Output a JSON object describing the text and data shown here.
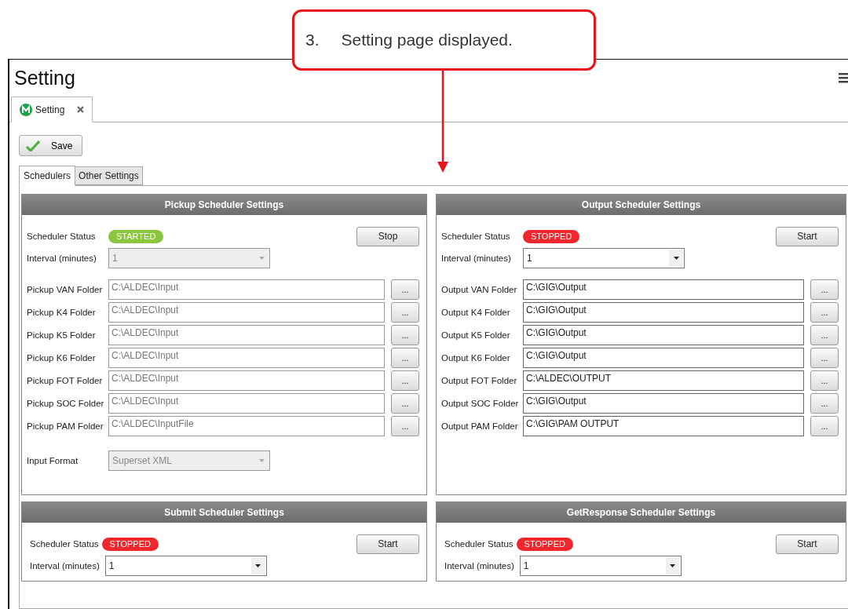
{
  "annotation": {
    "number": "3.",
    "text": "Setting page displayed."
  },
  "window": {
    "title": "Setting"
  },
  "doc_tabs": [
    {
      "label": "Setting",
      "selected": true,
      "closable": true
    }
  ],
  "save_button": "Save",
  "tabs": [
    {
      "label": "Schedulers",
      "selected": true
    },
    {
      "label": "Other Settings",
      "selected": false
    }
  ],
  "panels": [
    {
      "title": "Pickup Scheduler Settings",
      "status_label": "Scheduler Status",
      "status": "STARTED",
      "running": true,
      "action": "Stop",
      "interval_label": "Interval (minutes)",
      "interval": "1",
      "disabled": true,
      "folders": [
        {
          "label": "Pickup VAN Folder",
          "value": "C:\\ALDEC\\Input",
          "browse": "..."
        },
        {
          "label": "Pickup K4 Folder",
          "value": "C:\\ALDEC\\Input",
          "browse": "..."
        },
        {
          "label": "Pickup K5 Folder",
          "value": "C:\\ALDEC\\Input",
          "browse": "..."
        },
        {
          "label": "Pickup K6 Folder",
          "value": "C:\\ALDEC\\Input",
          "browse": "..."
        },
        {
          "label": "Pickup FOT Folder",
          "value": "C:\\ALDEC\\Input",
          "browse": "..."
        },
        {
          "label": "Pickup SOC Folder",
          "value": "C:\\ALDEC\\Input",
          "browse": "..."
        },
        {
          "label": "Pickup PAM Folder",
          "value": "C:\\ALDEC\\InputFile",
          "browse": "..."
        }
      ],
      "input_format": {
        "label": "Input Format",
        "value": "Superset XML"
      }
    },
    {
      "title": "Output Scheduler Settings",
      "status_label": "Scheduler Status",
      "status": "STOPPED",
      "running": false,
      "action": "Start",
      "interval_label": "Interval (minutes)",
      "interval": "1",
      "disabled": false,
      "folders": [
        {
          "label": "Output VAN Folder",
          "value": "C:\\GIG\\Output",
          "browse": "..."
        },
        {
          "label": "Output K4 Folder",
          "value": "C:\\GIG\\Output",
          "browse": "..."
        },
        {
          "label": "Output K5 Folder",
          "value": "C:\\GIG\\Output",
          "browse": "..."
        },
        {
          "label": "Output K6 Folder",
          "value": "C:\\GIG\\Output",
          "browse": "..."
        },
        {
          "label": "Output FOT Folder",
          "value": "C:\\ALDEC\\OUTPUT",
          "browse": "..."
        },
        {
          "label": "Output SOC Folder",
          "value": "C:\\GIG\\Output",
          "browse": "..."
        },
        {
          "label": "Output PAM Folder",
          "value": "C:\\GIG\\PAM OUTPUT",
          "browse": "..."
        }
      ]
    },
    {
      "title": "Submit Scheduler Settings",
      "status_label": "Scheduler Status",
      "status": "STOPPED",
      "running": false,
      "action": "Start",
      "interval_label": "Interval (minutes)",
      "interval": "1",
      "disabled": false
    },
    {
      "title": "GetResponse Scheduler Settings",
      "status_label": "Scheduler Status",
      "status": "STOPPED",
      "running": false,
      "action": "Start",
      "interval_label": "Interval (minutes)",
      "interval": "1",
      "disabled": false
    }
  ]
}
